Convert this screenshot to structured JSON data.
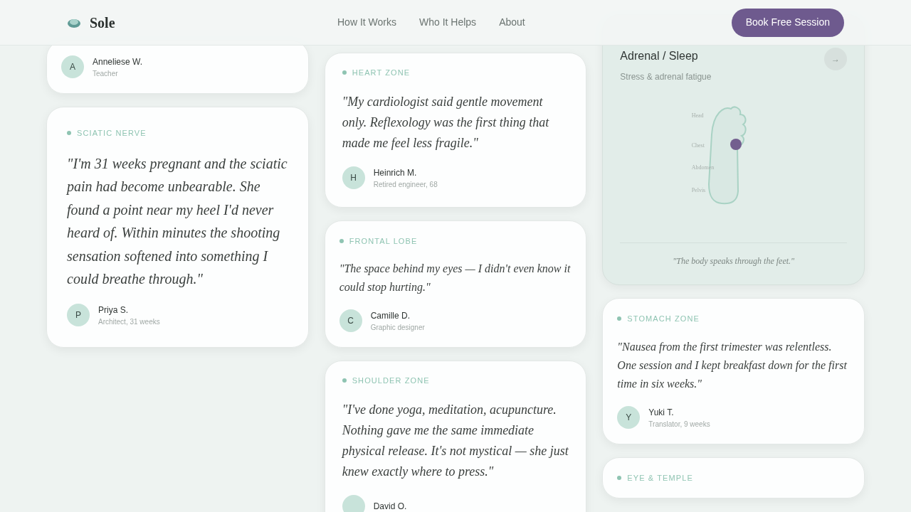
{
  "header": {
    "brand": "Sole",
    "nav": [
      {
        "label": "How It Works"
      },
      {
        "label": "Who It Helps"
      },
      {
        "label": "About"
      }
    ],
    "cta": "Book Free Session"
  },
  "columns": [
    [
      {
        "kind": "testimonial",
        "author": {
          "initial": "A",
          "name": "Anneliese W.",
          "role": "Teacher"
        }
      },
      {
        "kind": "featured",
        "zone": "SCIATIC NERVE",
        "quote": "\"I'm 31 weeks pregnant and the sciatic pain had become unbearable. She found a point near my heel I'd never heard of. Within minutes the shooting sensation softened into something I could breathe through.\"",
        "author": {
          "initial": "P",
          "name": "Priya S.",
          "role": "Architect, 31 weeks"
        }
      }
    ],
    [
      {
        "kind": "quote",
        "zone": "HEART ZONE",
        "quote": "\"My cardiologist said gentle movement only. Reflexology was the first thing that made me feel less fragile.\"",
        "author": {
          "initial": "H",
          "name": "Heinrich M.",
          "role": "Retired engineer, 68"
        }
      },
      {
        "kind": "testimonial",
        "zone": "FRONTAL LOBE",
        "quote": "\"The space behind my eyes — I didn't even know it could stop hurting.\"",
        "author": {
          "initial": "C",
          "name": "Camille D.",
          "role": "Graphic designer"
        }
      },
      {
        "kind": "quote",
        "zone": "SHOULDER ZONE",
        "quote": "\"I've done yoga, meditation, acupuncture. Nothing gave me the same immediate physical release. It's not mystical — she just knew exactly where to press.\"",
        "author": {
          "name": "David O."
        }
      }
    ],
    [
      {
        "kind": "map",
        "arrow": "→",
        "title": "Adrenal / Sleep",
        "subtitle": "Stress & adrenal fatigue",
        "labels": [
          "Head",
          "Chest",
          "Abdomen",
          "Pelvis"
        ],
        "caption": "\"The body speaks through the feet.\""
      },
      {
        "kind": "testimonial",
        "zone": "STOMACH ZONE",
        "quote": "\"Nausea from the first trimester was relentless. One session and I kept breakfast down for the first time in six weeks.\"",
        "author": {
          "initial": "Y",
          "name": "Yuki T.",
          "role": "Translator, 9 weeks"
        }
      },
      {
        "kind": "testimonial",
        "zone": "EYE & TEMPLE"
      }
    ]
  ]
}
